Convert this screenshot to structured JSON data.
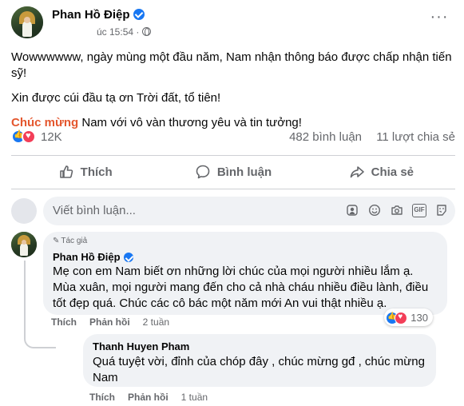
{
  "post": {
    "author": "Phan Hồ Điệp",
    "time": "úc 15:54 ·",
    "paragraph1": "Wowwwwww, ngày mùng một đầu năm, Nam nhận thông báo được chấp nhận tiến sỹ!",
    "paragraph2": "Xin được cúi đầu tạ ơn Trời đất, tổ tiên!",
    "highlight": "Chúc mừng",
    "paragraph3_rest": " Nam với vô vàn thương yêu và tin tưởng!",
    "reaction_count": "12K",
    "comment_count": "482 bình luận",
    "share_count": "11 lượt chia sẻ",
    "more": "···"
  },
  "actions": {
    "like": "Thích",
    "comment": "Bình luận",
    "share": "Chia sẻ"
  },
  "comment_input": {
    "placeholder": "Viết bình luận..."
  },
  "comments": [
    {
      "author_tag": "Tác giả",
      "author": "Phan Hồ Điệp",
      "text": "Mẹ con em Nam biết ơn những lời chúc của mọi người nhiều lắm ạ. Mùa xuân, mọi người mang đến cho cả nhà cháu nhiều điều lành, điều tốt đẹp quá. Chúc các cô bác một năm mới An vui thật nhiều ạ.",
      "like": "Thích",
      "reply": "Phản hồi",
      "time": "2 tuần",
      "reactions": "130"
    },
    {
      "author": "Thanh Huyen Pham",
      "text": "Quá tuyệt vời, đỉnh của chóp đây , chúc mừng gđ , chúc mừng Nam",
      "like": "Thích",
      "reply": "Phản hồi",
      "time": "1 tuần"
    }
  ],
  "colors": {
    "accent": "#1877f2",
    "love": "#f33e58",
    "highlight": "#e4572e"
  }
}
